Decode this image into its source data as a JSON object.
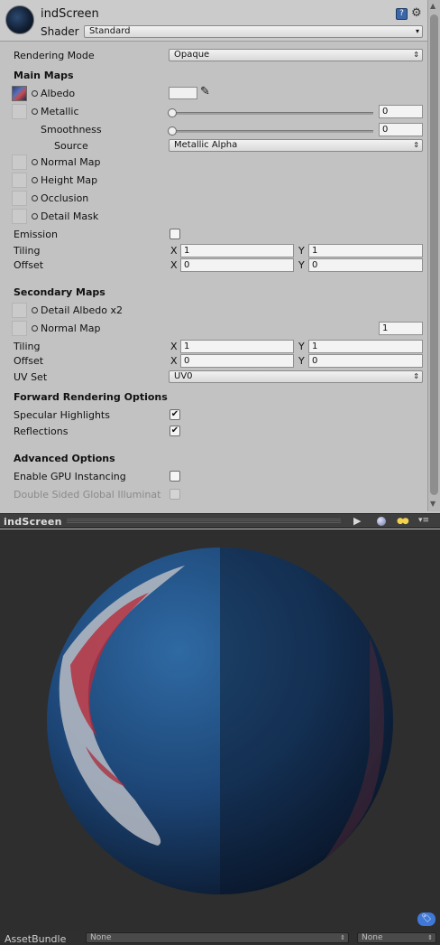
{
  "header": {
    "material_name": "indScreen",
    "shader_label": "Shader",
    "shader_value": "Standard",
    "help_icon": "book-help-icon",
    "settings_icon": "gear-icon"
  },
  "rendering_mode": {
    "label": "Rendering Mode",
    "value": "Opaque"
  },
  "main_maps": {
    "title": "Main Maps",
    "albedo_label": "Albedo",
    "albedo_color": "#f0f0f0",
    "metallic_label": "Metallic",
    "metallic_value": "0",
    "smoothness_label": "Smoothness",
    "smoothness_value": "0",
    "source_label": "Source",
    "source_value": "Metallic Alpha",
    "normal_map_label": "Normal Map",
    "height_map_label": "Height Map",
    "occlusion_label": "Occlusion",
    "detail_mask_label": "Detail Mask",
    "emission_label": "Emission",
    "tiling_label": "Tiling",
    "tiling_x": "1",
    "tiling_y": "1",
    "offset_label": "Offset",
    "offset_x": "0",
    "offset_y": "0",
    "x_label": "X",
    "y_label": "Y"
  },
  "secondary_maps": {
    "title": "Secondary Maps",
    "detail_albedo_label": "Detail Albedo x2",
    "normal_map_label": "Normal Map",
    "normal_scale": "1",
    "tiling_label": "Tiling",
    "tiling_x": "1",
    "tiling_y": "1",
    "offset_label": "Offset",
    "offset_x": "0",
    "offset_y": "0",
    "uv_set_label": "UV Set",
    "uv_set_value": "UV0"
  },
  "forward_rendering": {
    "title": "Forward Rendering Options",
    "specular_label": "Specular Highlights",
    "specular_checked": "✔",
    "reflections_label": "Reflections",
    "reflections_checked": "✔"
  },
  "advanced": {
    "title": "Advanced Options",
    "gpu_instancing_label": "Enable GPU Instancing",
    "double_sided_label": "Double Sided Global Illuminat"
  },
  "preview": {
    "title": "indScreen",
    "play_icon": "play-icon",
    "sphere_icon": "preview-sphere-icon",
    "light_icon": "light-icon",
    "menu_icon": "dropdown-menu-icon"
  },
  "footer": {
    "asset_bundle_label": "AssetBundle",
    "bundle_name": "None",
    "bundle_variant": "None"
  }
}
